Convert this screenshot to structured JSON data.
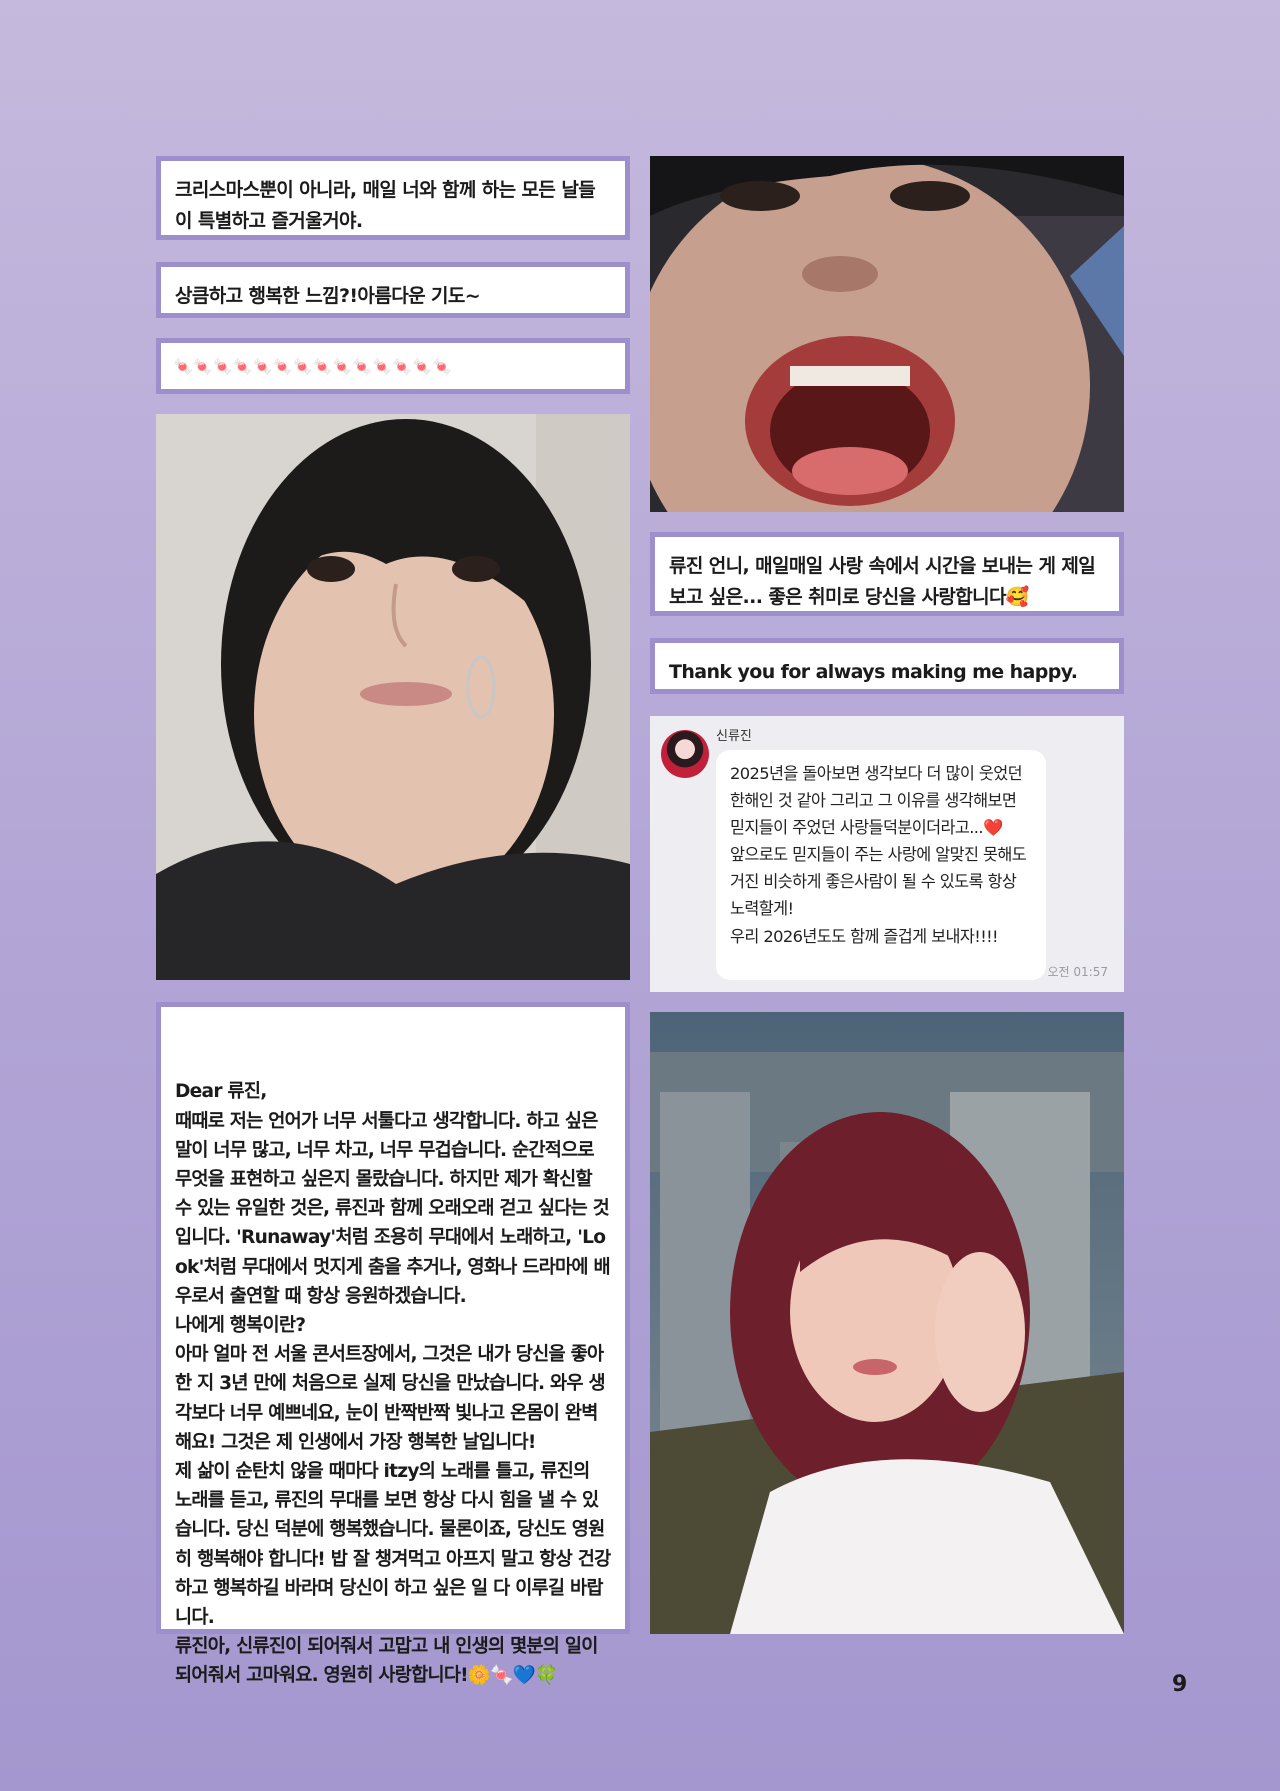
{
  "notes": {
    "note1": "크리스마스뿐이 아니라, 매일 너와 함께 하는 모든 날들이 특별하고 즐거울거야.",
    "note2": "상큼하고 행복한 느낌?!아름다운 기도~",
    "note3_emoji": "🍬🍬🍬🍬🍬🍬🍬🍬🍬🍬🍬🍬🍬🍬",
    "note4": "류진 언니, 매일매일 사랑 속에서 시간을 보내는 게 제일 보고 싶은... 좋은 취미로 당신을 사랑합니다🥰",
    "note5": "Thank you for always making me happy."
  },
  "chat": {
    "name": "신류진",
    "message": "2025년을 돌아보면 생각보다 더 많이 웃었던 한해인 것 같아 그리고 그 이유를 생각해보면 믿지들이 주었던 사랑들덕분이더라고...❤️\n앞으로도 믿지들이 주는 사랑에 알맞진 못해도 거진 비슷하게 좋은사람이 될 수 있도록 항상 노력할게!\n우리 2026년도도 함께 즐겁게 보내자!!!!",
    "time": "오전 01:57"
  },
  "letter": {
    "text": "Dear 류진,\n때때로 저는 언어가 너무 서툴다고 생각합니다. 하고 싶은 말이 너무 많고, 너무 차고, 너무 무겁습니다. 순간적으로 무엇을 표현하고 싶은지 몰랐습니다. 하지만 제가 확신할 수 있는 유일한 것은, 류진과 함께 오래오래 걷고 싶다는 것입니다. 'Runaway'처럼 조용히 무대에서 노래하고, 'Look'처럼 무대에서 멋지게 춤을 추거나, 영화나 드라마에 배우로서 출연할 때 항상 응원하겠습니다.\n나에게 행복이란?\n아마 얼마 전 서울 콘서트장에서, 그것은 내가 당신을 좋아한 지 3년 만에 처음으로 실제 당신을 만났습니다. 와우 생각보다 너무 예쁘네요, 눈이 반짝반짝 빛나고 온몸이 완벽해요! 그것은 제 인생에서 가장 행복한 날입니다!\n제 삶이 순탄치 않을 때마다 itzy의 노래를 틀고, 류진의 노래를 듣고, 류진의 무대를 보면 항상 다시 힘을 낼 수 있습니다. 당신 덕분에 행복했습니다. 물론이죠, 당신도 영원히 행복해야 합니다! 밥 잘 챙겨먹고 아프지 말고 항상 건강하고 행복하길 바라며 당신이 하고 싶은 일 다 이루길 바랍니다.\n류진아, 신류진이 되어줘서 고맙고 내 인생의 몇분의 일이 되어줘서 고마워요. 영원히 사랑합니다!🌼🍬💙🍀"
  },
  "page_number": "9",
  "colors": {
    "frame": "#9d8fcc",
    "background_top": "#c5b9dd",
    "background_bottom": "#a497cf"
  }
}
